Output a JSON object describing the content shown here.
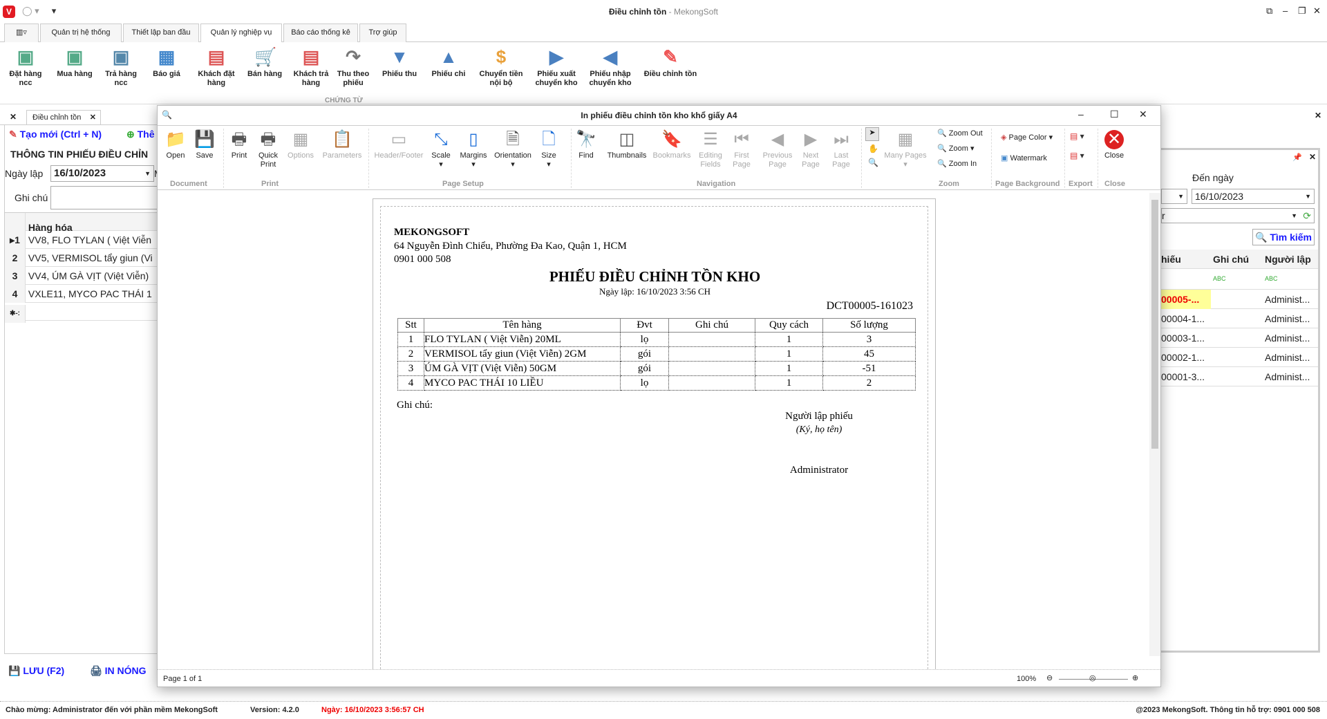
{
  "app": {
    "title": "Điều chỉnh tồn",
    "title_suffix": " - MekongSoft",
    "logo": "V"
  },
  "menu_tabs": [
    "Quản trị hệ thống",
    "Thiết lập ban đầu",
    "Quản lý nghiệp vụ",
    "Báo cáo thống kê",
    "Trợ giúp"
  ],
  "ribbon": {
    "group": "CHỨNG TỪ",
    "items": [
      {
        "label": "Đặt hàng ncc",
        "icon": "contact-card-icon"
      },
      {
        "label": "Mua hàng",
        "icon": "add-contact-icon"
      },
      {
        "label": "Trả hàng ncc",
        "icon": "edit-contact-icon"
      },
      {
        "label": "Báo giá",
        "icon": "calendar-user-icon"
      },
      {
        "label": "Khách đặt hàng",
        "icon": "cart-order-icon"
      },
      {
        "label": "Bán hàng",
        "icon": "cart-icon"
      },
      {
        "label": "Khách trả hàng",
        "icon": "cart-return-icon"
      },
      {
        "label": "Thu theo phiếu",
        "icon": "u-turn-icon"
      },
      {
        "label": "Phiếu thu",
        "icon": "arrow-down-icon"
      },
      {
        "label": "Phiếu chi",
        "icon": "arrow-up-icon"
      },
      {
        "label": "Chuyển tiền nội bộ",
        "icon": "coins-icon"
      },
      {
        "label": "Phiếu xuất chuyển kho",
        "icon": "arrow-right-icon"
      },
      {
        "label": "Phiếu nhập chuyển kho",
        "icon": "arrow-left-icon"
      },
      {
        "label": "Điều chỉnh tồn",
        "icon": "edit-text-icon"
      }
    ]
  },
  "doc_tab": "Điều chỉnh tồn",
  "left": {
    "new_btn": "Tạo mới (Ctrl + N)",
    "add_btn": "Thê",
    "section": "THÔNG TIN PHIẾU ĐIỀU CHỈN",
    "date_label": "Ngày lập",
    "date": "16/10/2023",
    "m_label": "M",
    "note_label": "Ghi chú",
    "grid_header": "Hàng hóa",
    "rows": [
      "VV8, FLO TYLAN ( Việt Viễn",
      "VV5, VERMISOL tẩy giun (Vi",
      "VV4, ÚM GÀ VỊT (Việt Viễn)",
      "VXLE11, MYCO PAC THÁI 1"
    ],
    "save_btn": "LƯU (F2)",
    "print_btn": "IN NÓNG"
  },
  "dialog": {
    "title": "In phiếu điều chỉnh tồn kho khổ giấy A4",
    "groups": [
      "Document",
      "Print",
      "Page Setup",
      "Navigation",
      "Zoom",
      "Page Background",
      "Export",
      "Close"
    ],
    "buttons": {
      "open": "Open",
      "save": "Save",
      "print": "Print",
      "quick_print": "Quick Print",
      "options": "Options",
      "parameters": "Parameters",
      "header_footer": "Header/Footer",
      "scale": "Scale",
      "margins": "Margins",
      "orientation": "Orientation",
      "size": "Size",
      "find": "Find",
      "thumbnails": "Thumbnails",
      "bookmarks": "Bookmarks",
      "editing_fields": "Editing Fields",
      "first_page": "First Page",
      "previous_page": "Previous Page",
      "next_page": "Next Page",
      "last_page": "Last Page",
      "many_pages": "Many Pages",
      "zoom_out": "Zoom Out",
      "zoom": "Zoom",
      "zoom_in": "Zoom In",
      "page_color": "Page Color",
      "watermark": "Watermark",
      "close": "Close"
    },
    "page_status": "Page 1 of 1",
    "zoom_level": "100%"
  },
  "report": {
    "company": "MEKONGSOFT",
    "address": "64 Nguyễn Đình Chiểu, Phường Đa Kao, Quận 1, HCM",
    "phone": "0901 000 508",
    "title": "PHIẾU ĐIỀU CHỈNH TỒN KHO",
    "date_line": "Ngày lập: 16/10/2023  3:56 CH",
    "code": "DCT00005-161023",
    "columns": [
      "Stt",
      "Tên hàng",
      "Đvt",
      "Ghi chú",
      "Quy cách",
      "Số lượng"
    ],
    "rows": [
      [
        "1",
        "FLO TYLAN ( Việt Viễn) 20ML",
        "lọ",
        "",
        "1",
        "3"
      ],
      [
        "2",
        "VERMISOL tẩy giun (Việt Viễn) 2GM",
        "gói",
        "",
        "1",
        "45"
      ],
      [
        "3",
        "ÚM GÀ VỊT (Việt Viễn) 50GM",
        "gói",
        "",
        "1",
        "-51"
      ],
      [
        "4",
        "MYCO PAC THÁI 10 LIỀU",
        "lọ",
        "",
        "1",
        "2"
      ]
    ],
    "note_label": "Ghi chú:",
    "signer_title": "Người lập phiếu",
    "signer_hint": "(Ký, họ tên)",
    "signer": "Administrator"
  },
  "right": {
    "to_date_label": "Đến ngày",
    "from_date": "",
    "to_date": "16/10/2023",
    "filter": "r",
    "search_btn": "Tìm kiếm",
    "columns": [
      "hiếu",
      "Ghi chú",
      "Người lập"
    ],
    "rows": [
      [
        "00005-...",
        "",
        "Administ..."
      ],
      [
        "00004-1...",
        "",
        "Administ..."
      ],
      [
        "00003-1...",
        "",
        "Administ..."
      ],
      [
        "00002-1...",
        "",
        "Administ..."
      ],
      [
        "00001-3...",
        "",
        "Administ..."
      ]
    ]
  },
  "status": {
    "welcome": "Chào mừng: Administrator đến với phần mềm MekongSoft",
    "version": "Version: 4.2.0",
    "date": "Ngày: 16/10/2023 3:56:57 CH",
    "copyright": "@2023 MekongSoft. Thông tin hỗ trợ: 0901 000 508"
  }
}
